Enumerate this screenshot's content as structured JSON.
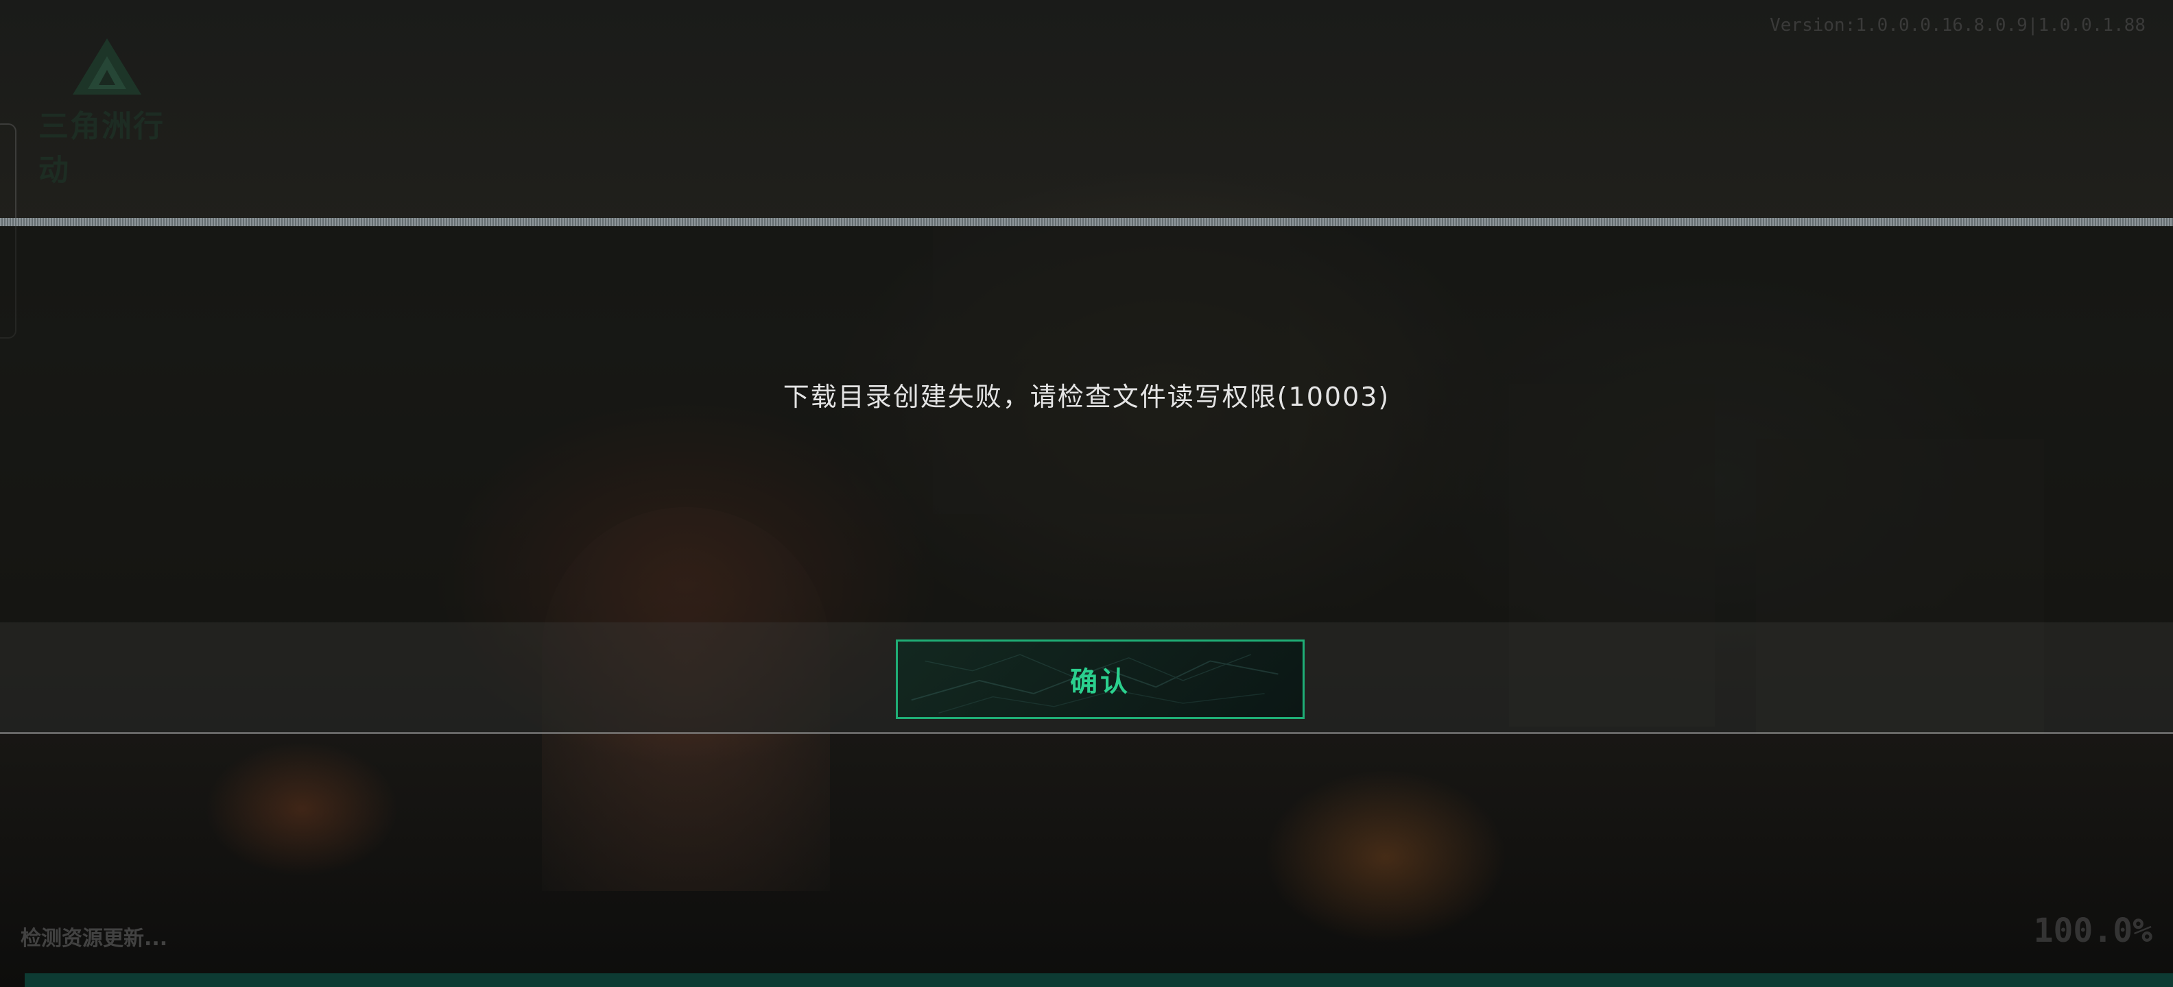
{
  "header": {
    "logo_text": "三角洲行动",
    "version_text": "Version:1.0.0.0.16.8.0.9|1.0.0.1.88"
  },
  "dialog": {
    "message": "下载目录创建失败，请检查文件读写权限(10003)",
    "confirm_label": "确认"
  },
  "footer": {
    "status_text": "检测资源更新...",
    "progress_text": "100.0%",
    "progress_value": 1.0
  },
  "colors": {
    "accent": "#2bd08e",
    "button_border": "#1fae76",
    "message_text": "#e4e4e4",
    "progress_track": "#0a2a26"
  },
  "icons": {
    "logo": "delta-triangle-logo-icon"
  }
}
